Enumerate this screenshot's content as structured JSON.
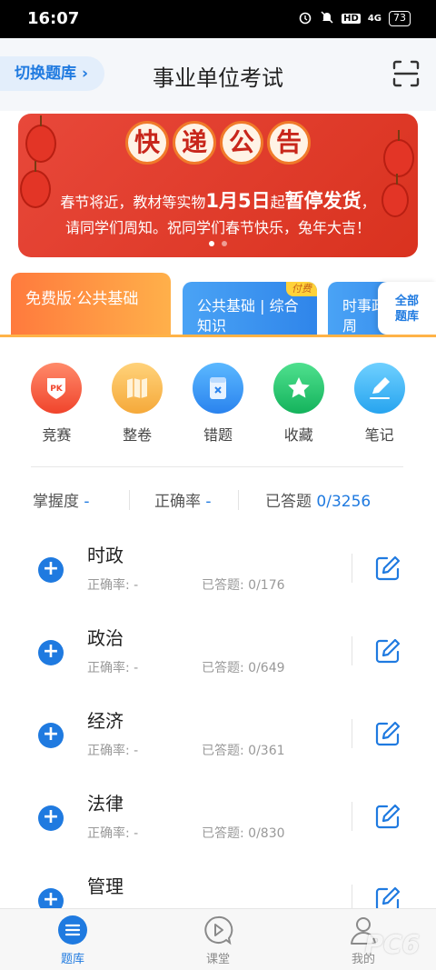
{
  "status_bar": {
    "time": "16:07",
    "battery": "73",
    "network": "4G",
    "hd": "HD"
  },
  "header": {
    "switch_label": "切换题库",
    "title": "事业单位考试",
    "scan_icon": "scan-icon"
  },
  "banner": {
    "title_chars": [
      "快",
      "递",
      "公",
      "告"
    ],
    "line1_pre": "春节将近，教材等实物",
    "line1_big": "1月5日",
    "line1_mid": "起",
    "line1_big2": "暂停发货",
    "line1_post": "，",
    "line2": "请同学们周知。祝同学们春节快乐，兔年大吉！",
    "colors": {
      "bg": "#e0402d",
      "text": "#ffffff"
    }
  },
  "cards": [
    {
      "label": "免费版·公共基础",
      "paid": ""
    },
    {
      "label": "公共基础 | 综合知识",
      "paid": "付费"
    },
    {
      "label": "时事政治(每周",
      "paid": ""
    }
  ],
  "all_library": {
    "line1": "全部",
    "line2": "题库"
  },
  "quick_actions": [
    {
      "label": "竞赛",
      "icon": "pk-icon"
    },
    {
      "label": "整卷",
      "icon": "book-icon"
    },
    {
      "label": "错题",
      "icon": "wrong-icon"
    },
    {
      "label": "收藏",
      "icon": "star-icon"
    },
    {
      "label": "笔记",
      "icon": "pen-icon"
    }
  ],
  "stats": {
    "mastery_label": "掌握度",
    "mastery_value": "-",
    "accuracy_label": "正确率",
    "accuracy_value": "-",
    "answered_label": "已答题",
    "answered_value": "0/3256"
  },
  "subjects": [
    {
      "name": "时政",
      "accuracy": "正确率: -",
      "answered": "已答题: 0/176"
    },
    {
      "name": "政治",
      "accuracy": "正确率: -",
      "answered": "已答题: 0/649"
    },
    {
      "name": "经济",
      "accuracy": "正确率: -",
      "answered": "已答题: 0/361"
    },
    {
      "name": "法律",
      "accuracy": "正确率: -",
      "answered": "已答题: 0/830"
    },
    {
      "name": "管理",
      "accuracy": "",
      "answered": ""
    }
  ],
  "tabs": [
    {
      "label": "题库",
      "icon": "question-bank-icon",
      "active": true
    },
    {
      "label": "课堂",
      "icon": "play-icon",
      "active": false
    },
    {
      "label": "我的",
      "icon": "person-icon",
      "active": false
    }
  ],
  "watermark": "PC6",
  "accent": "#1f7ae0"
}
